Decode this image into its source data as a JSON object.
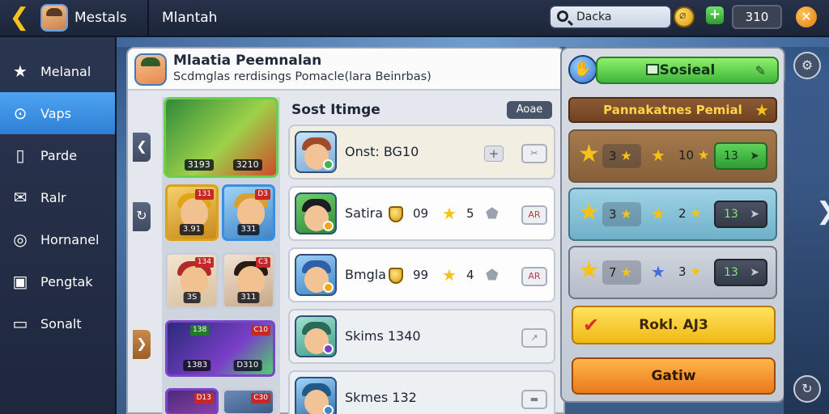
{
  "topbar": {
    "app_title": "Mestals",
    "section_title": "Mlantah",
    "search_value": "Dacka",
    "currency": "310",
    "icons": {
      "back": "back-arrow-icon",
      "coin": "coin-icon",
      "plus": "plus-icon",
      "close": "close-icon",
      "search": "search-icon"
    }
  },
  "sidebar": {
    "items": [
      {
        "label": "Melanal",
        "icon": "star-icon",
        "glyph": "★"
      },
      {
        "label": "Vaps",
        "icon": "gear-circle-icon",
        "glyph": "⊙"
      },
      {
        "label": "Parde",
        "icon": "document-icon",
        "glyph": "▯"
      },
      {
        "label": "Ralr",
        "icon": "mail-icon",
        "glyph": "✉"
      },
      {
        "label": "Hornanel",
        "icon": "ring-icon",
        "glyph": "◎"
      },
      {
        "label": "Pengtak",
        "icon": "calendar-icon",
        "glyph": "▣"
      },
      {
        "label": "Sonalt",
        "icon": "chat-icon",
        "glyph": "▭"
      }
    ],
    "active_index": 1
  },
  "panel": {
    "title": "Mlaatia Peemnalan",
    "subtitle": "Scdmglas rerdisings Pomacle(lara Beinrbas)"
  },
  "heroes": {
    "big": {
      "left_level": "3193",
      "right_level": "3210"
    },
    "cards": [
      {
        "tag": "131",
        "level": "3.91"
      },
      {
        "tag": "D3",
        "level": "331"
      },
      {
        "tag": "134",
        "level": "3S"
      },
      {
        "tag": "C3",
        "level": "311"
      },
      {
        "tag": "138",
        "level": "1383"
      },
      {
        "tag": "C10",
        "level": "D310"
      },
      {
        "tag": "D13",
        "level": ""
      },
      {
        "tag": "C30",
        "level": ""
      }
    ]
  },
  "list": {
    "title": "Sost Itimge",
    "button": "Aoae",
    "rows": [
      {
        "name": "Onst: BG10",
        "rank": "",
        "count": "",
        "action": ""
      },
      {
        "name": "Satira",
        "rank": "09",
        "count": "5",
        "action": "AR"
      },
      {
        "name": "Bmgla",
        "rank": "99",
        "count": "4",
        "action": "AR"
      },
      {
        "name": "Skims 1340",
        "rank": "",
        "count": "",
        "action": ""
      },
      {
        "name": "Skmes 132",
        "rank": "",
        "count": "",
        "action": ""
      }
    ]
  },
  "right_panel": {
    "social_label": "Sosieal",
    "header": "Pannakatnes Pemial",
    "cards": [
      {
        "pill": "3",
        "num": "10",
        "btn": "13"
      },
      {
        "pill": "3",
        "num": "2",
        "btn": "13"
      },
      {
        "pill": "7",
        "num": "3",
        "btn": "13"
      }
    ],
    "claim_label": "Rokl. AJ3",
    "orange_label": "Gatiw"
  }
}
